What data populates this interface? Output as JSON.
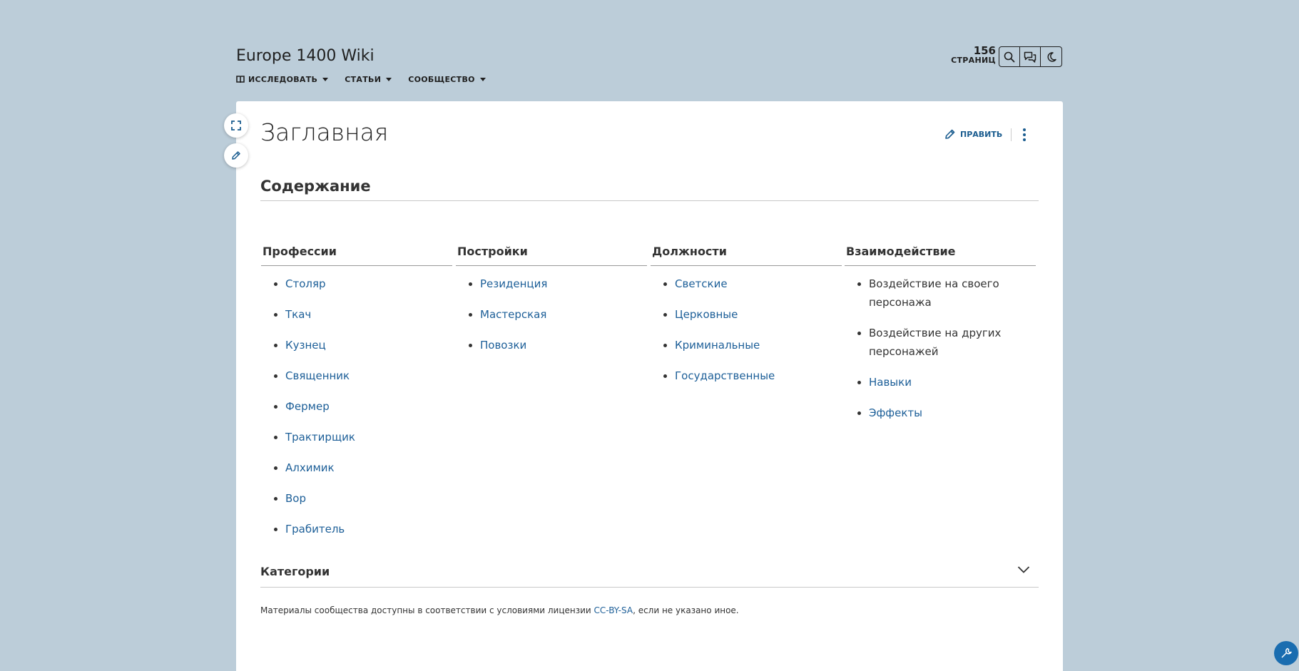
{
  "site": {
    "title": "Europe 1400 Wiki"
  },
  "nav": [
    {
      "label": "Исследовать",
      "icon": "book-icon"
    },
    {
      "label": "Статьи"
    },
    {
      "label": "Сообщество"
    }
  ],
  "page_count": {
    "number": "156",
    "label": "СТРАНИЦ"
  },
  "tools": [
    {
      "icon": "search-icon"
    },
    {
      "icon": "discussion-icon"
    },
    {
      "icon": "moon-icon"
    }
  ],
  "page": {
    "title": "Заглавная",
    "edit_label": "Править"
  },
  "contents": {
    "heading": "Содержание",
    "columns": [
      {
        "title": "Профессии",
        "items": [
          "Столяр",
          "Ткач",
          "Кузнец",
          "Священник",
          "Фермер",
          "Трактирщик",
          "Алхимик",
          "Вор",
          "Грабитель"
        ]
      },
      {
        "title": "Постройки",
        "items": [
          "Резиденция",
          "Мастерская",
          "Повозки"
        ]
      },
      {
        "title": "Должности",
        "items": [
          "Светские",
          "Церковные",
          "Криминальные",
          "Государственные"
        ]
      },
      {
        "title": "Взаимодействие",
        "items": [
          {
            "text": "Воздействие на своего персонажа",
            "link": false
          },
          {
            "text": "Воздействие на других персонажей",
            "link": false
          },
          {
            "text": "Навыки",
            "link": true
          },
          {
            "text": "Эффекты",
            "link": true
          }
        ]
      }
    ]
  },
  "categories": {
    "label": "Категории"
  },
  "license": {
    "before": "Материалы сообщества доступны в соответствии с условиями лицензии ",
    "link": "CC-BY-SA",
    "after": ", если не указано иное."
  },
  "colors": {
    "background": "#bccdd9",
    "link": "#1d5f98",
    "accent": "#1a6db0"
  }
}
